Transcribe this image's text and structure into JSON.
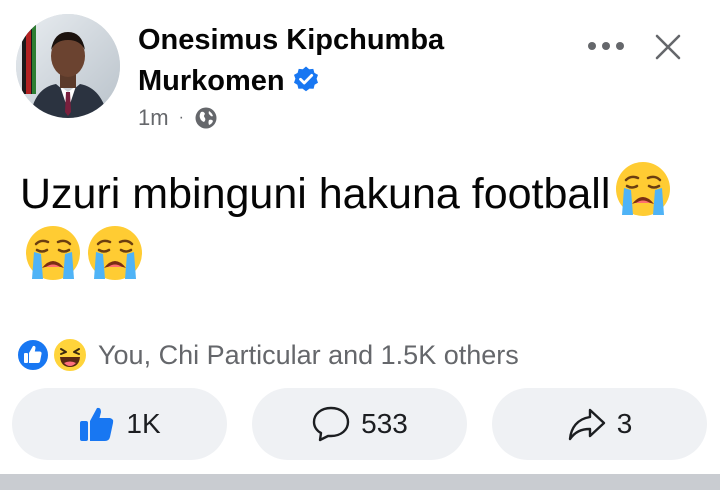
{
  "post": {
    "author_name": "Onesimus Kipchumba Murkomen",
    "verified": true,
    "time": "1m",
    "dot": "·",
    "privacy_icon": "globe-icon",
    "text": "Uzuri mbinguni hakuna football",
    "emoji_count": 3,
    "emoji": "loudly-crying-face"
  },
  "reactions": {
    "icons": [
      "like-reaction-icon",
      "haha-reaction-icon"
    ],
    "summary": "You, Chi Particular and 1.5K others"
  },
  "actions": {
    "like_count": "1K",
    "comment_count": "533",
    "share_count": "3"
  },
  "colors": {
    "brand_blue": "#1877F2",
    "secondary_text": "#65676B",
    "button_bg": "#EFF1F4"
  }
}
